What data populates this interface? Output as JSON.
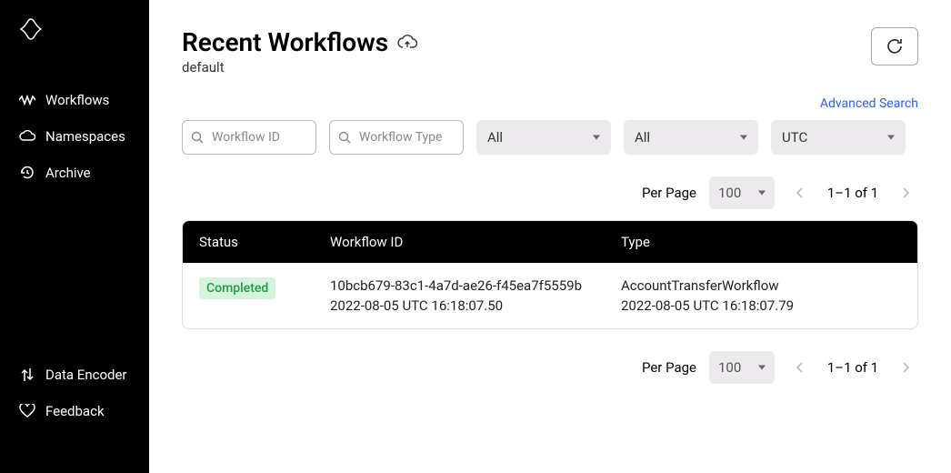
{
  "sidebar": {
    "items": [
      {
        "label": "Workflows"
      },
      {
        "label": "Namespaces"
      },
      {
        "label": "Archive"
      }
    ],
    "bottom": [
      {
        "label": "Data Encoder"
      },
      {
        "label": "Feedback"
      }
    ]
  },
  "header": {
    "title": "Recent Workflows",
    "subtitle": "default"
  },
  "advanced_search": "Advanced Search",
  "filters": {
    "workflow_id_placeholder": "Workflow ID",
    "workflow_type_placeholder": "Workflow Type",
    "status_select": "All",
    "status_select2": "All",
    "tz_select": "UTC"
  },
  "pagination": {
    "per_page_label": "Per Page",
    "per_page_value": "100",
    "range": "1–1 of 1"
  },
  "table": {
    "headers": {
      "status": "Status",
      "id": "Workflow ID",
      "type": "Type"
    },
    "rows": [
      {
        "status": "Completed",
        "id": "10bcb679-83c1-4a7d-ae26-f45ea7f5559b",
        "id_ts": "2022-08-05 UTC 16:18:07.50",
        "type": "AccountTransferWorkflow",
        "type_ts": "2022-08-05 UTC 16:18:07.79"
      }
    ]
  }
}
